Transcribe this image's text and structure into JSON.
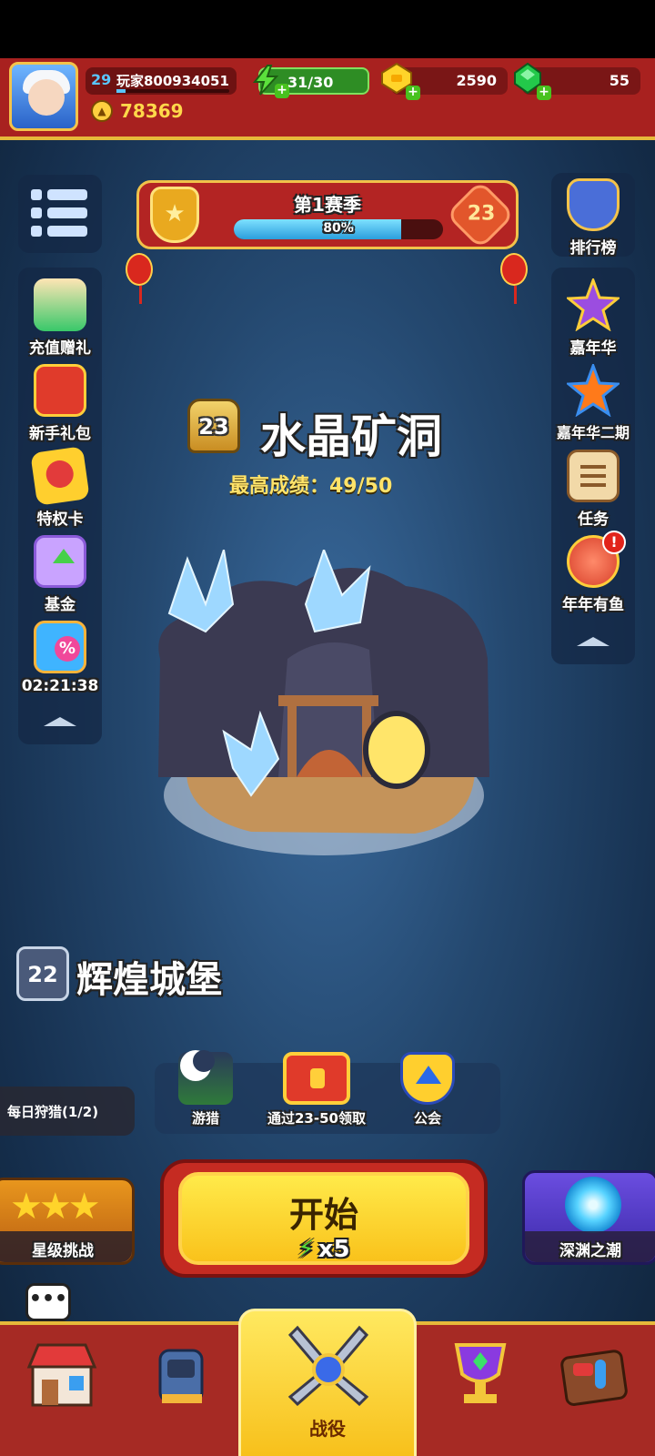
{
  "player": {
    "level": "29",
    "name": "玩家800934051",
    "power": "78369"
  },
  "resources": {
    "energy": "31/30",
    "gold": "2590",
    "gems": "55"
  },
  "season": {
    "title": "第1赛季",
    "progress_percent": 80,
    "progress_label": "80%",
    "level": "23"
  },
  "left_menu": [
    {
      "label": "充值赠礼",
      "icon": "avatar-gift-icon"
    },
    {
      "label": "新手礼包",
      "icon": "gift-box-icon"
    },
    {
      "label": "特权卡",
      "icon": "privilege-card-icon"
    },
    {
      "label": "基金",
      "icon": "fund-chest-icon"
    },
    {
      "label": "02:21:38",
      "icon": "sale-gift-icon"
    }
  ],
  "right_menu": [
    {
      "label": "排行榜",
      "icon": "leaderboard-icon"
    },
    {
      "label": "嘉年华",
      "icon": "purple-star-icon"
    },
    {
      "label": "嘉年华二期",
      "icon": "orange-star-icon"
    },
    {
      "label": "任务",
      "icon": "task-scroll-icon"
    },
    {
      "label": "年年有鱼",
      "icon": "fish-event-icon"
    }
  ],
  "current_level": {
    "number": "23",
    "name": "水晶矿洞",
    "best_score": "最高成绩：49/50"
  },
  "prev_level": {
    "number": "22",
    "name": "辉煌城堡"
  },
  "actions": [
    {
      "label": "游猎",
      "icon": "safari-icon"
    },
    {
      "label": "通过23-50领取",
      "icon": "treasure-chest-icon"
    },
    {
      "label": "公会",
      "icon": "guild-shield-icon"
    }
  ],
  "daily_hunt": "每日狩猎(1/2)",
  "start": {
    "label": "开始",
    "cost": "x5"
  },
  "star_challenge": "星级挑战",
  "abyss": "深渊之潮",
  "bottom_nav": {
    "active_label": "战役"
  },
  "colors": {
    "red_bar": "#a8211f",
    "gold_trim": "#e6b93a",
    "energy_green": "#2e8d24",
    "start_yellow": "#f9c21b"
  }
}
